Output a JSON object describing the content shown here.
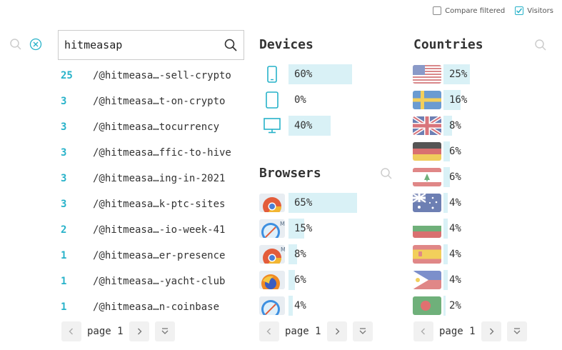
{
  "options": {
    "compare_label": "Compare filtered",
    "visitors_label": "Visitors",
    "compare_checked": false,
    "visitors_checked": true
  },
  "search": {
    "value": "hitmeasap"
  },
  "pages": {
    "rows": [
      {
        "count": "25",
        "path": "/@hitmeasa…-sell-crypto"
      },
      {
        "count": "3",
        "path": "/@hitmeasa…t-on-crypto"
      },
      {
        "count": "3",
        "path": "/@hitmeasa…tocurrency"
      },
      {
        "count": "3",
        "path": "/@hitmeasa…ffic-to-hive"
      },
      {
        "count": "3",
        "path": "/@hitmeasa…ing-in-2021"
      },
      {
        "count": "3",
        "path": "/@hitmeasa…k-ptc-sites"
      },
      {
        "count": "2",
        "path": "/@hitmeasa…-io-week-41"
      },
      {
        "count": "1",
        "path": "/@hitmeasa…er-presence"
      },
      {
        "count": "1",
        "path": "/@hitmeasa…-yacht-club"
      },
      {
        "count": "1",
        "path": "/@hitmeasa…n-coinbase"
      }
    ],
    "pager_label": "page 1"
  },
  "devices": {
    "title": "Devices",
    "rows": [
      {
        "icon": "mobile-icon",
        "label": "60%",
        "value": 60
      },
      {
        "icon": "tablet-icon",
        "label": "0%",
        "value": 0
      },
      {
        "icon": "desktop-icon",
        "label": "40%",
        "value": 40
      }
    ]
  },
  "browsers": {
    "title": "Browsers",
    "rows": [
      {
        "icon": "chrome-icon",
        "label": "65%",
        "value": 65
      },
      {
        "icon": "safari-mobile-icon",
        "label": "15%",
        "value": 15
      },
      {
        "icon": "chrome-mobile-icon",
        "label": "8%",
        "value": 8
      },
      {
        "icon": "firefox-icon",
        "label": "6%",
        "value": 6
      },
      {
        "icon": "safari-icon",
        "label": "4%",
        "value": 4
      }
    ],
    "pager_label": "page 1"
  },
  "countries": {
    "title": "Countries",
    "rows": [
      {
        "icon": "flag-us-icon",
        "label": "25%",
        "value": 25
      },
      {
        "icon": "flag-se-icon",
        "label": "16%",
        "value": 16
      },
      {
        "icon": "flag-gb-icon",
        "label": "8%",
        "value": 8
      },
      {
        "icon": "flag-de-icon",
        "label": "6%",
        "value": 6
      },
      {
        "icon": "flag-lb-icon",
        "label": "6%",
        "value": 6
      },
      {
        "icon": "flag-au-icon",
        "label": "4%",
        "value": 4
      },
      {
        "icon": "flag-bg-icon",
        "label": "4%",
        "value": 4
      },
      {
        "icon": "flag-es-icon",
        "label": "4%",
        "value": 4
      },
      {
        "icon": "flag-ph-icon",
        "label": "4%",
        "value": 4
      },
      {
        "icon": "flag-bd-icon",
        "label": "2%",
        "value": 2
      }
    ],
    "pager_label": "page 1"
  },
  "colors": {
    "accent": "#27b2c9",
    "bar": "#d9f1f6"
  }
}
